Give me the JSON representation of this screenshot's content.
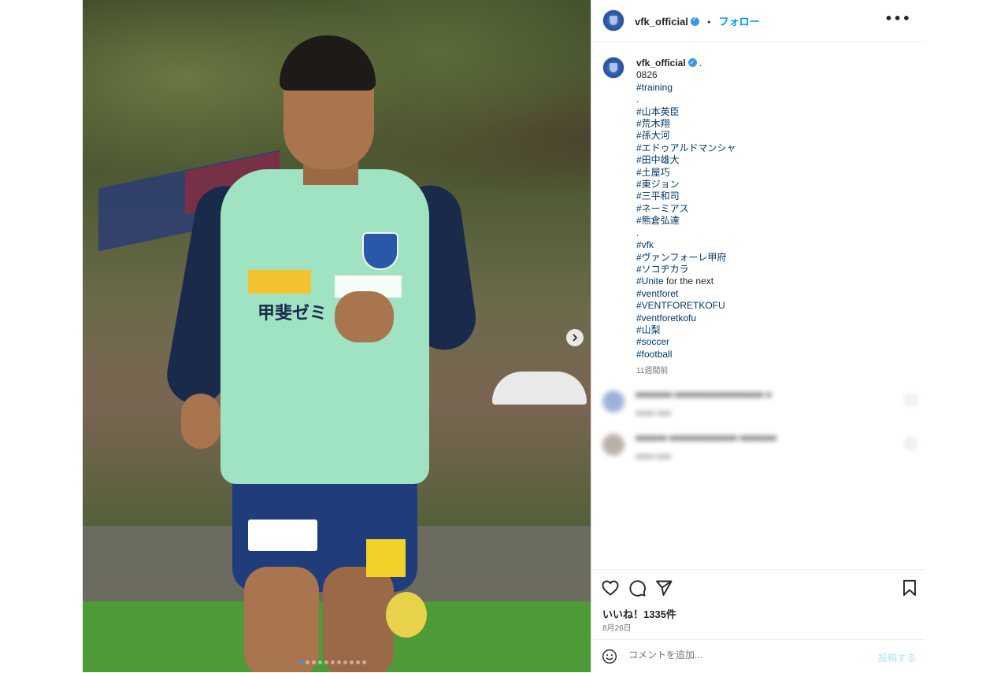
{
  "header": {
    "username": "vfk_official",
    "separator": "•",
    "follow_label": "フォロー",
    "more_label": "•••"
  },
  "caption": {
    "username": "vfk_official",
    "suffix": ".",
    "lines": [
      {
        "text": "0826",
        "tag": false
      },
      {
        "text": "#training",
        "tag": true
      },
      {
        "text": ".",
        "tag": false
      },
      {
        "text": "#山本英臣",
        "tag": true
      },
      {
        "text": "#荒木翔",
        "tag": true
      },
      {
        "text": "#孫大河",
        "tag": true
      },
      {
        "text": "#エドゥアルドマンシャ",
        "tag": true
      },
      {
        "text": "#田中雄大",
        "tag": true
      },
      {
        "text": "#土屋巧",
        "tag": true
      },
      {
        "text": "#東ジョン",
        "tag": true
      },
      {
        "text": "#三平和司",
        "tag": true
      },
      {
        "text": "#ネーミアス",
        "tag": true
      },
      {
        "text": "#熊倉弘達",
        "tag": true
      },
      {
        "text": ".",
        "tag": false
      },
      {
        "text": "#vfk",
        "tag": true
      },
      {
        "text": "#ヴァンフォーレ甲府",
        "tag": true
      },
      {
        "text": "#ソコヂカラ",
        "tag": true
      },
      {
        "text": "#Unite",
        "tag": true,
        "rest": " for the next"
      },
      {
        "text": "#ventforet",
        "tag": true
      },
      {
        "text": "#VENTFORETKOFU",
        "tag": true
      },
      {
        "text": "#ventforetkofu",
        "tag": true
      },
      {
        "text": "#山梨",
        "tag": true
      },
      {
        "text": "#soccer",
        "tag": true
      },
      {
        "text": "#football",
        "tag": true
      }
    ],
    "time_ago": "11週間前"
  },
  "actions": {
    "likes": "いいね！1335件",
    "date": "8月26日"
  },
  "comment_bar": {
    "placeholder": "コメントを追加...",
    "post_label": "投稿する"
  },
  "carousel": {
    "dot_count": 11,
    "active_index": 0
  },
  "icons": {
    "like": "heart-icon",
    "comment": "comment-icon",
    "share": "share-icon",
    "save": "bookmark-icon",
    "emoji": "emoji-icon",
    "next": "chevron-right-icon"
  },
  "colors": {
    "link": "#00376b",
    "follow": "#0095f6",
    "verified": "#3897f0",
    "post_disabled": "#b2dffc"
  }
}
